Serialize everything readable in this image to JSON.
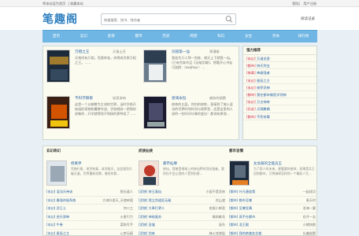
{
  "topbar": {
    "left": [
      "将本站设为首页",
      "收藏本站"
    ],
    "right": [
      "登陆",
      "用户注册"
    ]
  },
  "header": {
    "logo": "笔趣阁",
    "search_placeholder": "快速搜索、找书、找作者",
    "search_icon": "search-icon",
    "reading_record": "阅读记录"
  },
  "nav": [
    "首页",
    "玄幻",
    "武侠",
    "都市",
    "历史",
    "网游",
    "科幻",
    "女生",
    "完本",
    "排行榜"
  ],
  "featured": [
    {
      "title": "万相之王",
      "author": "天蚕土豆",
      "desc": "天地间有万相，而我李洛，终将成为那万相之王。……"
    },
    {
      "title": "剑道第一仙",
      "author": "萧瑾瑜",
      "desc": "我若为万人拜一剑修，诸天上下就我一仙。(已有完本作品《无敌剑域》，想看开心书友可加群：iaaqfwyc：..."
    },
    {
      "title": "不科学御兽",
      "author": "轻泉流响",
      "desc": "这是一个以御兽为主流的世界。当时学校开始组织宠物和魔兽作战，学校就成一把独创迹象的…开学就得找不到搞的那种笑了……"
    },
    {
      "title": "星域永恒",
      "author": "偏执的翅膀",
      "desc": "修炼的五层，你别的修炼，直接到了城入混沌的世界时的时间与境界里…还是这里的人说的一些时间与情的变化！都说有那他…"
    }
  ],
  "sidebar": {
    "title": "强力推荐",
    "rows": [
      {
        "cat": "[玄幻]",
        "name": "万道龙皇"
      },
      {
        "cat": "[都市]",
        "name": "快乐到五"
      },
      {
        "cat": "[修真]",
        "name": "神级强者"
      },
      {
        "cat": "[玄幻]",
        "name": "星辰之主"
      },
      {
        "cat": "[玄幻]",
        "name": "修罗武神"
      },
      {
        "cat": "[都市]",
        "name": "我在都市做医学领神"
      },
      {
        "cat": "[玄幻]",
        "name": "万古神帝"
      },
      {
        "cat": "[历史]",
        "name": "贞观憨婿"
      },
      {
        "cat": "[都市]",
        "name": "不死帝尊"
      }
    ]
  },
  "columns": [
    {
      "title": "玄幻奇幻",
      "feat_title": "修真界",
      "feat_desc": "凭借行星，前世修真，拿剑指天，这会拔剑大破天道，世界重新洗牌，曾经的我…",
      "list": [
        {
          "a": "[玄幻] 混沌天帝诀",
          "b": "隐无道人"
        },
        {
          "a": "[玄幻] 最强终极系统",
          "b": "大海针游天_天使帝国"
        },
        {
          "a": "[玄幻] 武王士",
          "b": "何二三"
        },
        {
          "a": "[玄幻] 逆天邪神",
          "b": "火星引力"
        },
        {
          "a": "[玄幻] 牛卷",
          "b": "菜狗写手"
        },
        {
          "a": "[玄幻] 星辰之主",
          "b": "心梦无痕"
        }
      ]
    },
    {
      "title": "武侠仙侠",
      "feat_title": "都市仙尊",
      "feat_desc": "修仙，我曾是地球上的修仙界的顶尖强者，我再也不会让我的人受到伤害…",
      "list": [
        {
          "a": "[武侠] 修玉真仙",
          "b": "小面不是武林"
        },
        {
          "a": "[武侠] 我立剑道亚无敌",
          "b": "花山渡"
        },
        {
          "a": "[武侠] 大奉打更人",
          "b": "卖报小郎君"
        },
        {
          "a": "[武侠] 神秘复苏",
          "b": "佛前献花"
        },
        {
          "a": "[武侠] 圣墟",
          "b": "辰东"
        },
        {
          "a": "[武侠] 剑来",
          "b": "烽火戏诸侯"
        }
      ]
    },
    {
      "title": "都市言情",
      "feat_title": "女总裁的全能兵王",
      "feat_desc": "为了家人的未来，更重要的使命，如果是兵王回到都市，又将演绎怎样的一个精彩人生…",
      "list": [
        {
          "a": "[都市] 叶凡唐若雪",
          "b": "一起成功"
        },
        {
          "a": "[都市] 都市至尊",
          "b": "乘天时"
        },
        {
          "a": "[都市] 至尊狂婿",
          "b": "沧海一粟"
        },
        {
          "a": "[都市] 高手在都市",
          "b": "花开一念"
        },
        {
          "a": "[都市] 龙王殿",
          "b": "小猪快跑"
        },
        {
          "a": "[都市] 我的绝美女总裁",
          "b": "长着翅膀"
        }
      ]
    }
  ]
}
